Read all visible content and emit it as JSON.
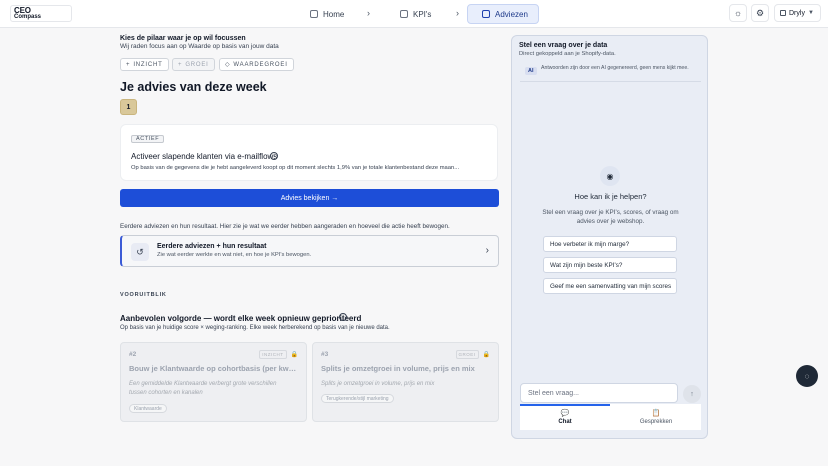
{
  "logo": {
    "line1": "CEO",
    "line2": "Compass"
  },
  "nav": {
    "items": [
      {
        "label": "Home",
        "icon": "home-icon"
      },
      {
        "label": "KPI's",
        "icon": "chart-icon"
      },
      {
        "label": "Adviezen",
        "icon": "advice-icon",
        "active": true
      }
    ],
    "separator": "›"
  },
  "toolbar": {
    "theme_icon": "sun-icon",
    "settings_icon": "gear-icon",
    "store_label": "Dryly",
    "store_caret": "▼"
  },
  "focus": {
    "title": "Kies de pilaar waar je op wil focussen",
    "subtitle": "Wij raden focus aan op Waarde op basis van jouw data",
    "pills": [
      {
        "icon": "+",
        "label": "INZICHT"
      },
      {
        "icon": "+",
        "label": "GROEI",
        "disabled": true
      },
      {
        "icon": "◇",
        "label": "WAARDEGROEI"
      }
    ]
  },
  "main": {
    "heading": "Je advies van deze week",
    "step_number": "1",
    "active_card": {
      "tag": "ACTIEF",
      "title": "Activeer slapende klanten via e-mailflows",
      "info_icon": "i",
      "description": "Op basis van de gegevens die je hebt aangeleverd koopt op dit moment slechts 1,9% van je totale klantenbestand deze maan..."
    },
    "cta_label": "Advies bekijken →",
    "earlier_intro": "Eerdere adviezen en hun resultaat. Hier zie je wat we eerder hebben aangeraden en hoeveel die actie heeft bewogen.",
    "earlier_card": {
      "icon": "↺",
      "title": "Eerdere adviezen + hun resultaat",
      "subtitle": "Zie wat eerder werkte en wat niet, en hoe je KPI's bewogen.",
      "arrow": "›"
    },
    "outlook_label": "VOORUITBLIK",
    "recommended": {
      "title": "Aanbevolen volgorde — wordt elke week opnieuw geprioriteerd",
      "info_icon": "i",
      "subtitle": "Op basis van je huidige score × weging-ranking. Elke week herberekend op basis van je nieuwe data.",
      "cards": [
        {
          "num": "#2",
          "tag": "INZICHT",
          "lock": "🔒",
          "title": "Bouw je Klantwaarde op cohortbasis (per kwarta...",
          "description": "Een gemiddelde Klantwaarde verbergt grote verschillen tussen cohorten en kanalen",
          "chip": "Klantwaarde"
        },
        {
          "num": "#3",
          "tag": "GROEI",
          "lock": "🔒",
          "title": "Splits je omzetgroei in volume, prijs en mix",
          "description": "Splits je omzetgroei in volume, prijs en mix",
          "chip": "Terugkerende/stijl marketing"
        }
      ]
    }
  },
  "chat": {
    "title": "Stel een vraag over je data",
    "subtitle": "Direct gekoppeld aan je Shopify-data.",
    "ai_badge": "AI",
    "ai_note": "Antwoorden zijn door een AI gegenereerd, geen mens kijkt mee.",
    "bot_icon": "◉",
    "help_title": "Hoe kan ik je helpen?",
    "help_sub": "Stel een vraag over je KPI's, scores, of vraag om advies over je webshop.",
    "suggestions": [
      "Hoe verbeter ik mijn marge?",
      "Wat zijn mijn beste KPI's?",
      "Geef me een samenvatting van mijn scores"
    ],
    "input_placeholder": "Stel een vraag...",
    "send_icon": "↑",
    "tabs": [
      {
        "icon": "💬",
        "label": "Chat",
        "active": true
      },
      {
        "icon": "📋",
        "label": "Gesprekken"
      }
    ]
  },
  "fab_icon": "◌"
}
